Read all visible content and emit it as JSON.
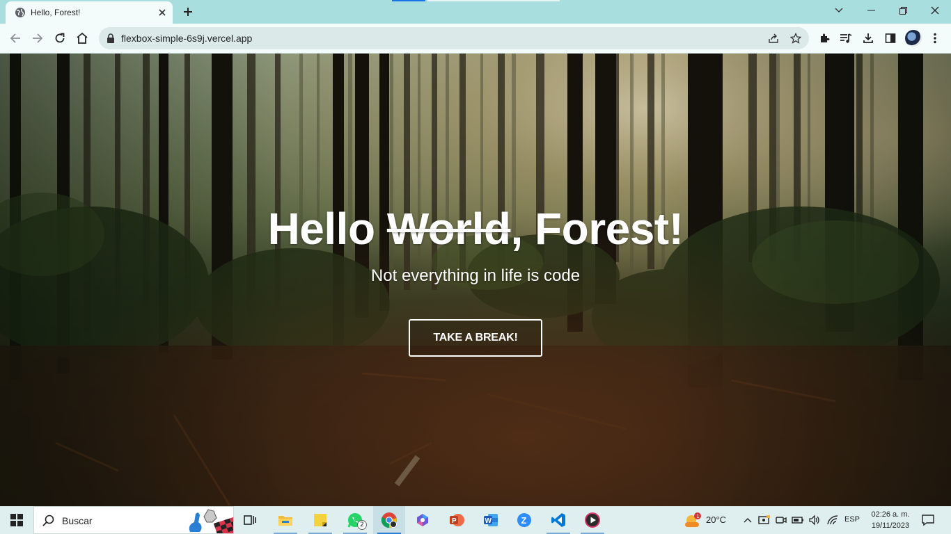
{
  "browser": {
    "tab_title": "Hello, Forest!",
    "url": "flexbox-simple-6s9j.vercel.app"
  },
  "page": {
    "title_hello": "Hello",
    "title_struck": "World",
    "title_rest": ", Forest!",
    "subtitle": "Not everything in life is code",
    "cta_label": "TAKE A BREAK!"
  },
  "taskbar": {
    "search_placeholder": "Buscar",
    "whatsapp_badge": "2",
    "weather_badge": "1",
    "weather_temp": "20°C",
    "language": "ESP",
    "time": "02:26 a. m.",
    "date": "19/11/2023"
  },
  "colors": {
    "tabstrip": "#a8dede",
    "toolbar": "#f3fbfb",
    "taskbar": "#dfefef",
    "accent": "#2b7fd6"
  },
  "icons": {
    "tab_favicon": "globe-icon",
    "back": "arrow-left-icon",
    "forward": "arrow-right-icon",
    "reload": "reload-icon",
    "home": "home-icon"
  }
}
